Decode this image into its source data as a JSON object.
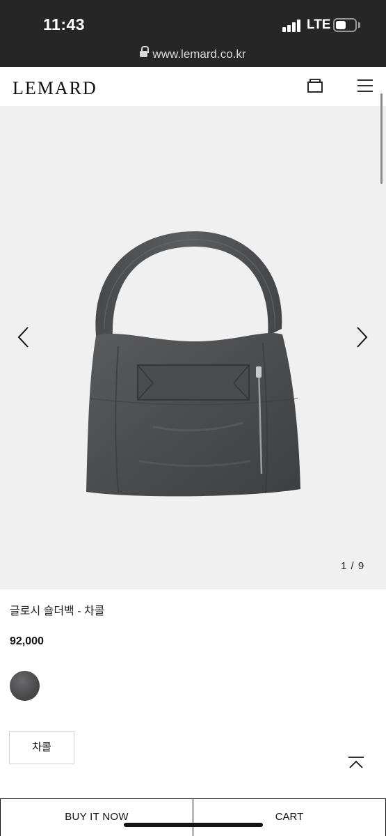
{
  "status_bar": {
    "time": "11:43",
    "network": "LTE",
    "battery_level": 0.55
  },
  "browser": {
    "url": "www.lemard.co.kr"
  },
  "header": {
    "logo": "LEMARD"
  },
  "gallery": {
    "counter": "1 / 9",
    "current": 1,
    "total": 9
  },
  "product": {
    "name": "글로시 숄더백 - 차콜",
    "price": "92,000",
    "swatch_color": "#4a4a4c",
    "option_label": "차콜"
  },
  "actions": {
    "buy_label": "BUY IT NOW",
    "cart_label": "CART"
  },
  "colors": {
    "status_bg": "#262626",
    "gallery_bg": "#f0f0f0",
    "bag_color": "#4e4f51"
  }
}
